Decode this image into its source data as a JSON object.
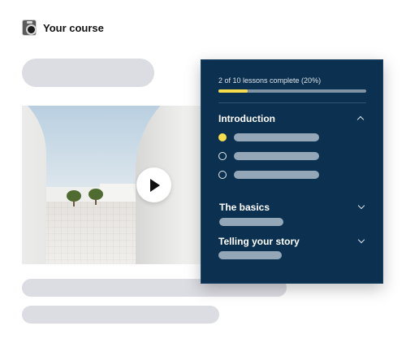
{
  "course": {
    "title": "Your course"
  },
  "video": {
    "play_icon": "play-icon"
  },
  "panel": {
    "progress": {
      "text": "2 of 10 lessons complete (20%)",
      "completed": 2,
      "total": 10,
      "percent": 20
    },
    "sections": [
      {
        "title": "Introduction",
        "expanded": true,
        "chevron_icon": "chevron-up-icon",
        "lessons": [
          {
            "status": "complete"
          },
          {
            "status": "incomplete"
          },
          {
            "status": "incomplete"
          }
        ]
      },
      {
        "title": "The basics",
        "expanded": false,
        "chevron_icon": "chevron-down-icon"
      },
      {
        "title": "Telling your story",
        "expanded": false,
        "chevron_icon": "chevron-down-icon"
      }
    ]
  },
  "colors": {
    "panel_bg": "#0c3150",
    "accent": "#f7dd4a",
    "skeleton": "#dcdce3",
    "placeholder_bar": "#93a7b8"
  }
}
